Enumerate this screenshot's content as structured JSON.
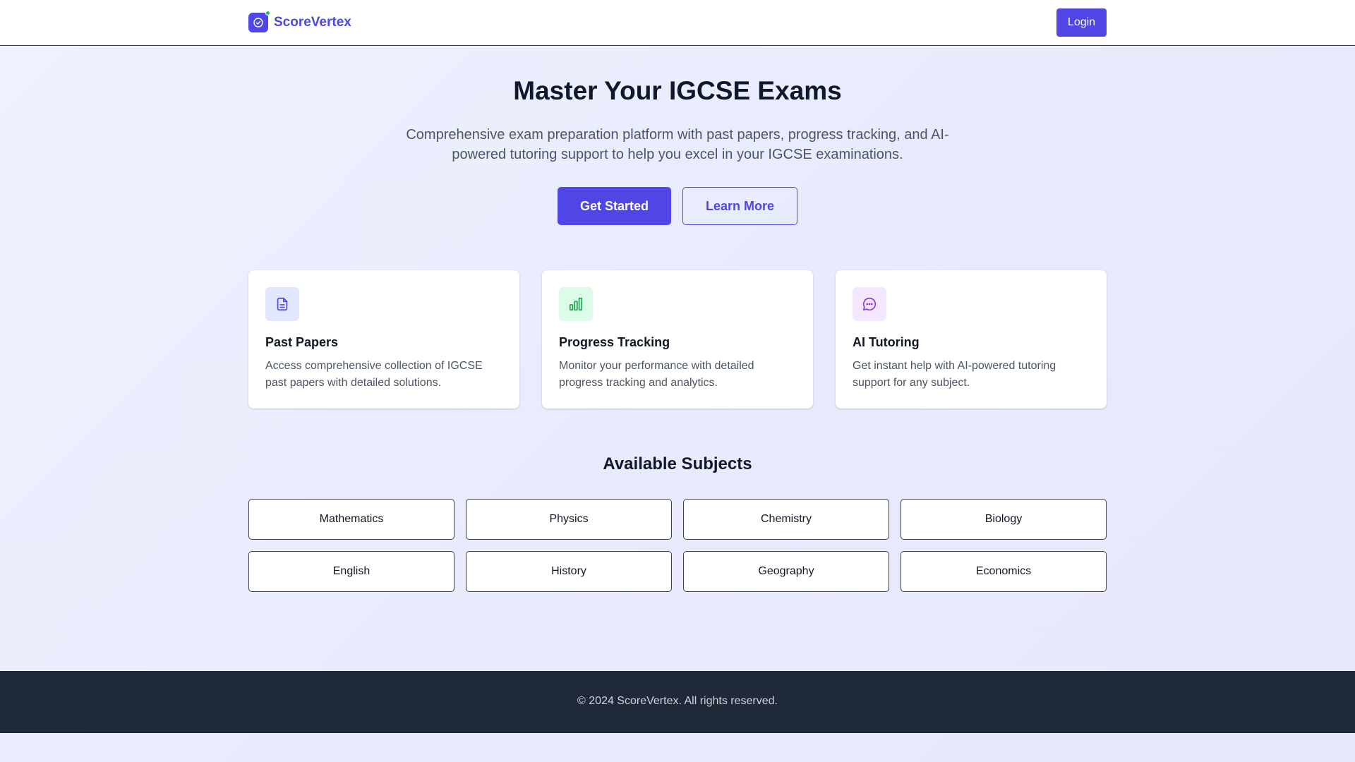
{
  "header": {
    "brand": "ScoreVertex",
    "login_label": "Login"
  },
  "hero": {
    "title": "Master Your IGCSE Exams",
    "subtitle": "Comprehensive exam preparation platform with past papers, progress tracking, and AI-powered tutoring support to help you excel in your IGCSE examinations.",
    "primary_cta": "Get Started",
    "secondary_cta": "Learn More"
  },
  "features": [
    {
      "title": "Past Papers",
      "description": "Access comprehensive collection of IGCSE past papers with detailed solutions.",
      "icon": "document-icon",
      "icon_bg": "#e0e7ff",
      "icon_color": "#4f46e5"
    },
    {
      "title": "Progress Tracking",
      "description": "Monitor your performance with detailed progress tracking and analytics.",
      "icon": "bar-chart-icon",
      "icon_bg": "#dcfce7",
      "icon_color": "#16a34a"
    },
    {
      "title": "AI Tutoring",
      "description": "Get instant help with AI-powered tutoring support for any subject.",
      "icon": "chat-icon",
      "icon_bg": "#f3e8ff",
      "icon_color": "#9333ea"
    }
  ],
  "subjects": {
    "title": "Available Subjects",
    "items": [
      "Mathematics",
      "Physics",
      "Chemistry",
      "Biology",
      "English",
      "History",
      "Geography",
      "Economics"
    ]
  },
  "footer": {
    "copyright": "© 2024 ScoreVertex. All rights reserved."
  },
  "colors": {
    "accent": "#4f46e5",
    "footer_bg": "#1f2937"
  }
}
